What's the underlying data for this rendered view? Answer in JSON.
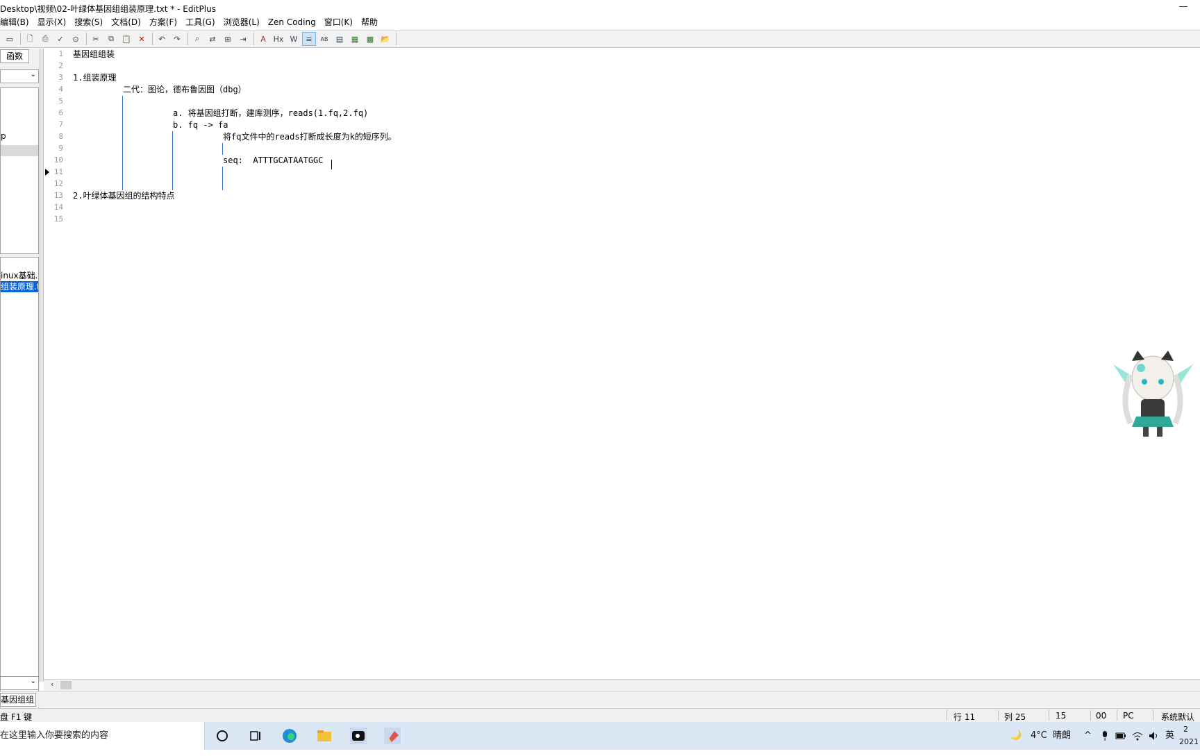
{
  "window": {
    "title": "Desktop\\视频\\02-叶绿体基因组组装原理.txt * - EditPlus"
  },
  "menu": [
    "编辑(B)",
    "显示(X)",
    "搜索(S)",
    "文档(D)",
    "方案(F)",
    "工具(G)",
    "浏览器(L)",
    "Zen Coding",
    "窗口(K)",
    "帮助"
  ],
  "toolbar": {
    "icons": [
      "new-icon",
      "print-preview-icon",
      "print-icon",
      "spell-check-icon",
      "browser-icon",
      "cut-icon",
      "copy-icon",
      "paste-icon",
      "delete-icon",
      "undo-icon",
      "redo-icon",
      "find-icon",
      "replace-icon",
      "find-in-files-icon",
      "goto-icon",
      "font-icon",
      "hex-icon",
      "wordwrap-icon",
      "indent-guide-icon",
      "column-icon",
      "ruler-icon",
      "run-icon",
      "build-icon",
      "folder-icon"
    ],
    "glyphs": [
      "▭",
      "🗋",
      "⎙",
      "✓",
      "⊙",
      "✂",
      "⧉",
      "📋",
      "✕",
      "↶",
      "↷",
      "⌕",
      "⇄",
      "⊞",
      "⇥",
      "A",
      "Hx",
      "W",
      "≡",
      "AB",
      "▤",
      "▦",
      "▩",
      "📂"
    ]
  },
  "leftpanel": {
    "tab_label": "函数",
    "tree_item": "p",
    "files": [
      "inux基础.t",
      "组装原理.t"
    ]
  },
  "editor": {
    "lines": [
      {
        "n": "1",
        "text": "基因组组装"
      },
      {
        "n": "2",
        "text": ""
      },
      {
        "n": "3",
        "text": "1.组装原理"
      },
      {
        "n": "4",
        "text": "二代：图论，德布鲁因图（dbg）"
      },
      {
        "n": "5",
        "text": ""
      },
      {
        "n": "6",
        "text": "a. 将基因组打断，建库测序，reads(1.fq,2.fq)"
      },
      {
        "n": "7",
        "text": "b. fq -> fa"
      },
      {
        "n": "8",
        "text": "将fq文件中的reads打断成长度为k的短序列。"
      },
      {
        "n": "9",
        "text": ""
      },
      {
        "n": "10",
        "text": "seq:  ATTTGCATAATGGC"
      },
      {
        "n": "11",
        "text": ""
      },
      {
        "n": "12",
        "text": ""
      },
      {
        "n": "13",
        "text": "2.叶绿体基因组的结构特点"
      },
      {
        "n": "14",
        "text": ""
      },
      {
        "n": "15",
        "text": ""
      }
    ]
  },
  "doctab": {
    "label": "基因组组"
  },
  "status": {
    "hint": "盘 F1 键",
    "row": "行 11",
    "col": "列 25",
    "lines": "15",
    "code": "00",
    "pc": "PC",
    "encoding": "系统默认"
  },
  "taskbar": {
    "search_placeholder": "在这里输入你要搜索的内容",
    "weather": "4°C",
    "weather_desc": "晴朗",
    "ime": "英",
    "time": "2",
    "date": "2021"
  }
}
